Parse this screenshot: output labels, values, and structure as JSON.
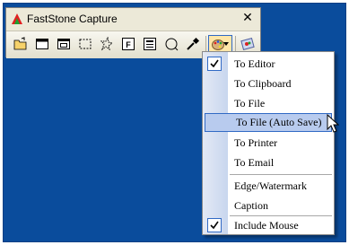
{
  "window": {
    "title": "FastStone Capture",
    "close_glyph": "✕"
  },
  "toolbar": {
    "buttons": [
      {
        "name": "open-icon"
      },
      {
        "name": "capture-active-window-icon"
      },
      {
        "name": "capture-window-object-icon"
      },
      {
        "name": "capture-rectangular-region-icon"
      },
      {
        "name": "capture-freehand-region-icon"
      },
      {
        "name": "capture-full-screen-icon"
      },
      {
        "name": "capture-scrolling-window-icon"
      },
      {
        "name": "capture-fixed-region-icon"
      },
      {
        "name": "color-picker-icon"
      },
      {
        "name": "output-options-icon"
      },
      {
        "name": "settings-icon"
      }
    ]
  },
  "menu": {
    "items": [
      {
        "label": "To Editor",
        "checked": true
      },
      {
        "label": "To Clipboard",
        "checked": false
      },
      {
        "label": "To File",
        "checked": false
      },
      {
        "label": "To File (Auto Save)",
        "checked": false,
        "highlighted": true
      },
      {
        "label": "To Printer",
        "checked": false
      },
      {
        "label": "To Email",
        "checked": false
      },
      {
        "label": "Edge/Watermark",
        "checked": false
      },
      {
        "label": "Caption",
        "checked": false
      },
      {
        "label": "Include Mouse",
        "checked": true
      }
    ]
  },
  "colors": {
    "desktop": "#0a4c9c",
    "menu_highlight": "#b8cbee",
    "accent": "#316ac5"
  }
}
